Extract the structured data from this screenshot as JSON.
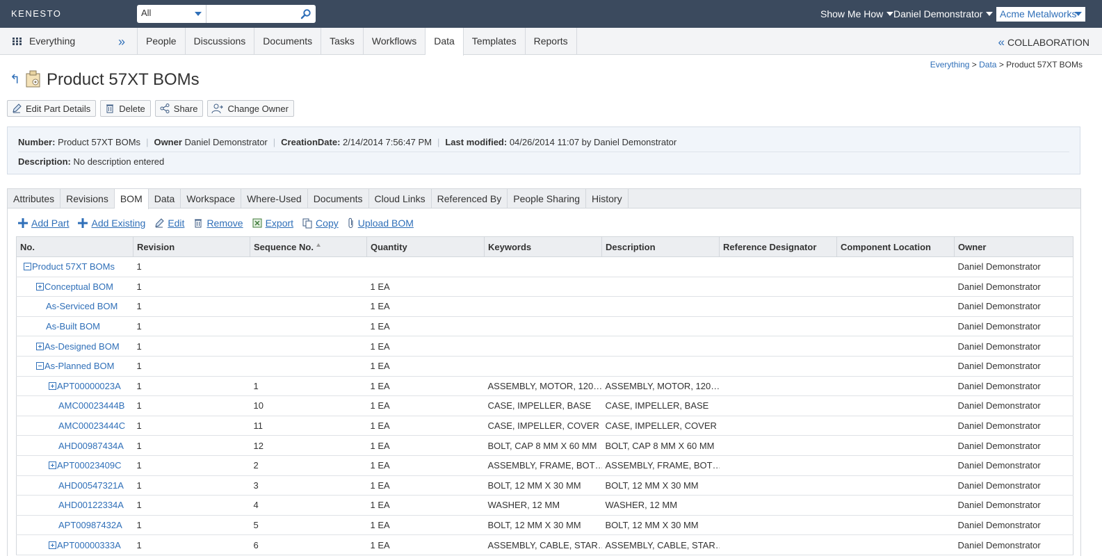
{
  "topbar": {
    "logo": "KENESTO",
    "search": {
      "scope": "All",
      "placeholder": ""
    },
    "show_me_how": "Show Me How",
    "user": "Daniel Demonstrator",
    "tenant": "Acme Metalworks"
  },
  "nav": {
    "everything": "Everything",
    "tabs": [
      "People",
      "Discussions",
      "Documents",
      "Tasks",
      "Workflows",
      "Data",
      "Templates",
      "Reports"
    ],
    "active_tab": "Data",
    "collaboration": "COLLABORATION"
  },
  "breadcrumb": {
    "items": [
      "Everything",
      "Data"
    ],
    "current": "Product 57XT BOMs"
  },
  "page": {
    "title": "Product 57XT BOMs"
  },
  "actions": [
    "Edit Part Details",
    "Delete",
    "Share",
    "Change Owner"
  ],
  "info": {
    "number_label": "Number:",
    "number": "Product 57XT BOMs",
    "owner_label": "Owner",
    "owner": "Daniel Demonstrator",
    "creation_label": "CreationDate:",
    "creation": "2/14/2014 7:56:47 PM",
    "modified_label": "Last modified:",
    "modified": "04/26/2014 11:07 by Daniel Demonstrator",
    "description_label": "Description:",
    "description": "No description entered"
  },
  "subtabs": [
    "Attributes",
    "Revisions",
    "BOM",
    "Data",
    "Workspace",
    "Where-Used",
    "Documents",
    "Cloud Links",
    "Referenced By",
    "People Sharing",
    "History"
  ],
  "active_subtab": "BOM",
  "bom_tools": [
    "Add Part",
    "Add Existing",
    "Edit",
    "Remove",
    "Export",
    "Copy",
    "Upload BOM"
  ],
  "table": {
    "columns": [
      "No.",
      "Revision",
      "Sequence No.",
      "Quantity",
      "Keywords",
      "Description",
      "Reference Designator",
      "Component Location",
      "Owner"
    ],
    "rows": [
      {
        "level": 0,
        "toggle": "minus",
        "no": "Product 57XT BOMs",
        "rev": "1",
        "seq": "",
        "qty": "",
        "kw": "",
        "desc": "",
        "ref": "",
        "loc": "",
        "owner": "Daniel Demonstrator"
      },
      {
        "level": 1,
        "toggle": "plus",
        "no": "Conceptual BOM",
        "rev": "1",
        "seq": "",
        "qty": "1 EA",
        "kw": "",
        "desc": "",
        "ref": "",
        "loc": "",
        "owner": "Daniel Demonstrator"
      },
      {
        "level": 1,
        "toggle": "",
        "no": "As-Serviced BOM",
        "rev": "1",
        "seq": "",
        "qty": "1 EA",
        "kw": "",
        "desc": "",
        "ref": "",
        "loc": "",
        "owner": "Daniel Demonstrator"
      },
      {
        "level": 1,
        "toggle": "",
        "no": "As-Built BOM",
        "rev": "1",
        "seq": "",
        "qty": "1 EA",
        "kw": "",
        "desc": "",
        "ref": "",
        "loc": "",
        "owner": "Daniel Demonstrator"
      },
      {
        "level": 1,
        "toggle": "plus",
        "no": "As-Designed BOM",
        "rev": "1",
        "seq": "",
        "qty": "1 EA",
        "kw": "",
        "desc": "",
        "ref": "",
        "loc": "",
        "owner": "Daniel Demonstrator"
      },
      {
        "level": 1,
        "toggle": "minus",
        "no": "As-Planned BOM",
        "rev": "1",
        "seq": "",
        "qty": "1 EA",
        "kw": "",
        "desc": "",
        "ref": "",
        "loc": "",
        "owner": "Daniel Demonstrator"
      },
      {
        "level": 2,
        "toggle": "plus",
        "no": "APT00000023A",
        "rev": "1",
        "seq": "1",
        "qty": "1 EA",
        "kw": "ASSEMBLY, MOTOR, 120…",
        "desc": "ASSEMBLY, MOTOR, 120…",
        "ref": "",
        "loc": "",
        "owner": "Daniel Demonstrator"
      },
      {
        "level": 2,
        "toggle": "",
        "no": "AMC00023444B",
        "rev": "1",
        "seq": "10",
        "qty": "1 EA",
        "kw": "CASE, IMPELLER, BASE",
        "desc": "CASE, IMPELLER, BASE",
        "ref": "",
        "loc": "",
        "owner": "Daniel Demonstrator"
      },
      {
        "level": 2,
        "toggle": "",
        "no": "AMC00023444C",
        "rev": "1",
        "seq": "11",
        "qty": "1 EA",
        "kw": "CASE, IMPELLER, COVER",
        "desc": "CASE, IMPELLER, COVER",
        "ref": "",
        "loc": "",
        "owner": "Daniel Demonstrator"
      },
      {
        "level": 2,
        "toggle": "",
        "no": "AHD00987434A",
        "rev": "1",
        "seq": "12",
        "qty": "1 EA",
        "kw": "BOLT, CAP 8 MM X 60 MM",
        "desc": "BOLT, CAP 8 MM X 60 MM",
        "ref": "",
        "loc": "",
        "owner": "Daniel Demonstrator"
      },
      {
        "level": 2,
        "toggle": "plus",
        "no": "APT00023409C",
        "rev": "1",
        "seq": "2",
        "qty": "1 EA",
        "kw": "ASSEMBLY, FRAME, BOT…",
        "desc": "ASSEMBLY, FRAME, BOT…",
        "ref": "",
        "loc": "",
        "owner": "Daniel Demonstrator"
      },
      {
        "level": 2,
        "toggle": "",
        "no": "AHD00547321A",
        "rev": "1",
        "seq": "3",
        "qty": "1 EA",
        "kw": "BOLT, 12 MM X 30 MM",
        "desc": "BOLT, 12 MM X 30 MM",
        "ref": "",
        "loc": "",
        "owner": "Daniel Demonstrator"
      },
      {
        "level": 2,
        "toggle": "",
        "no": "AHD00122334A",
        "rev": "1",
        "seq": "4",
        "qty": "1 EA",
        "kw": "WASHER, 12 MM",
        "desc": "WASHER, 12 MM",
        "ref": "",
        "loc": "",
        "owner": "Daniel Demonstrator"
      },
      {
        "level": 2,
        "toggle": "",
        "no": "APT00987432A",
        "rev": "1",
        "seq": "5",
        "qty": "1 EA",
        "kw": "BOLT, 12 MM X 30 MM",
        "desc": "BOLT, 12 MM X 30 MM",
        "ref": "",
        "loc": "",
        "owner": "Daniel Demonstrator"
      },
      {
        "level": 2,
        "toggle": "plus",
        "no": "APT00000333A",
        "rev": "1",
        "seq": "6",
        "qty": "1 EA",
        "kw": "ASSEMBLY, CABLE, STAR…",
        "desc": "ASSEMBLY, CABLE, STAR…",
        "ref": "",
        "loc": "",
        "owner": "Daniel Demonstrator"
      }
    ]
  }
}
